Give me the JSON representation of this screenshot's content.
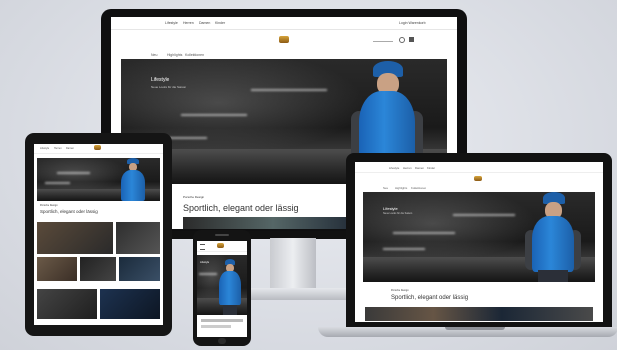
{
  "monitor": {
    "nav": [
      "Lifestyle",
      "Herren",
      "Damen",
      "Kinder"
    ],
    "nav_right": "Login  Warenkorb",
    "subnav": [
      "Neu",
      "Highlights",
      "Kollektionen"
    ],
    "hero_title": "Lifestyle",
    "hero_subtitle": "Neue Looks für die Saison",
    "headline_small": "Porsche Design",
    "headline_big": "Sportlich, elegant oder lässig"
  },
  "tablet": {
    "nav": [
      "Lifestyle",
      "Herren",
      "Damen"
    ],
    "headline_small": "Porsche Design",
    "headline_big": "Sportlich, elegant oder lässig"
  },
  "laptop": {
    "nav": [
      "Lifestyle",
      "Herren",
      "Damen",
      "Kinder"
    ],
    "subnav": [
      "Neu",
      "Highlights",
      "Kollektionen"
    ],
    "hero_title": "Lifestyle",
    "hero_subtitle": "Neue Looks für die Saison",
    "headline_small": "Porsche Design",
    "headline_big": "Sportlich, elegant oder lässig"
  },
  "phone": {
    "title": "Lifestyle"
  }
}
